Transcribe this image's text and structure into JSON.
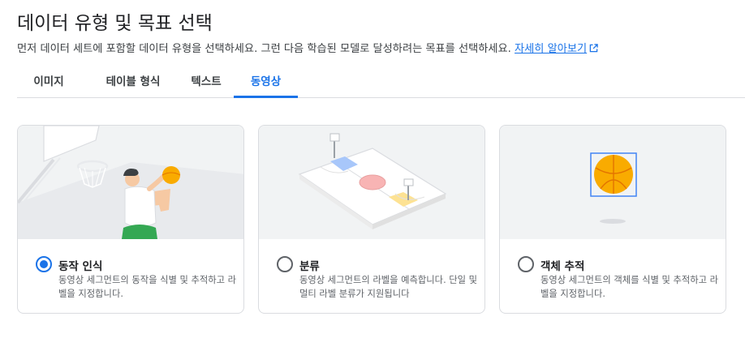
{
  "header": {
    "title": "데이터 유형 및 목표 선택",
    "subtitle": "먼저 데이터 세트에 포함할 데이터 유형을 선택하세요. 그런 다음 학습된 모델로 달성하려는 목표를 선택하세요.",
    "learn_more": "자세히 알아보기",
    "learn_more_icon": "open-in-new-icon"
  },
  "tabs": [
    {
      "label": "이미지",
      "active": false
    },
    {
      "label": "테이블 형식",
      "active": false
    },
    {
      "label": "텍스트",
      "active": false
    },
    {
      "label": "동영상",
      "active": true
    }
  ],
  "options": [
    {
      "title": "동작 인식",
      "description": "동영상 세그먼트의 동작을 식별 및 추적하고 라벨을 지정합니다.",
      "selected": true,
      "illustration": "basketball-player-shooting"
    },
    {
      "title": "분류",
      "description": "동영상 세그먼트의 라벨을 예측합니다. 단일 및 멀티 라벨 분류가 지원됩니다",
      "selected": false,
      "illustration": "basketball-court"
    },
    {
      "title": "객체 추적",
      "description": "동영상 세그먼트의 객체를 식별 및 추적하고 라벨을 지정합니다.",
      "selected": false,
      "illustration": "basketball-in-bounding-box"
    }
  ],
  "colors": {
    "accent": "#1a73e8",
    "illustration_bg": "#f1f3f4",
    "ball": "#f9ab00",
    "bounding_box": "#4285f4",
    "jersey": "#34a853"
  }
}
